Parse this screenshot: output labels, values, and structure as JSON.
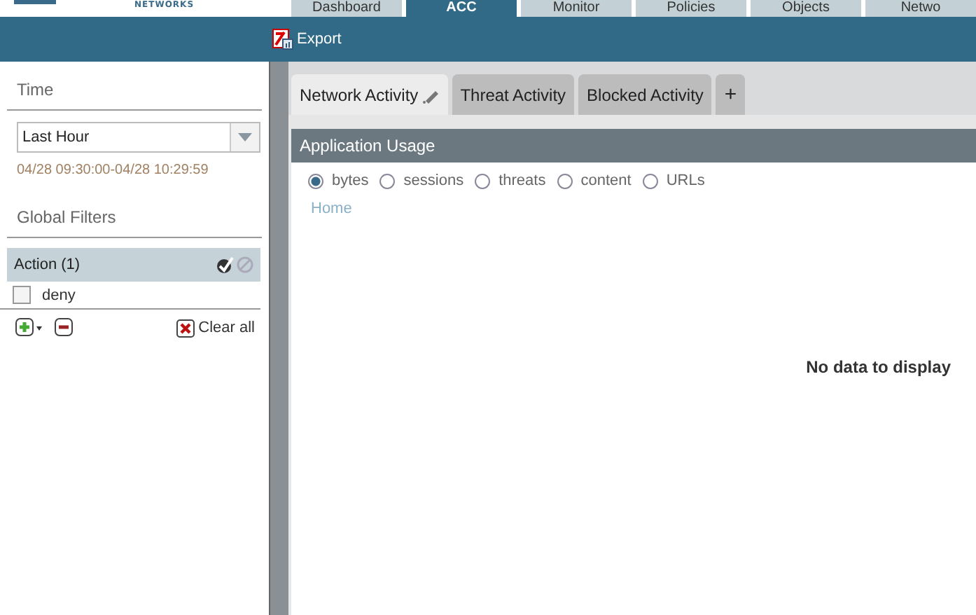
{
  "logo": {
    "subtitle": "NETWORKS"
  },
  "nav_tabs": [
    {
      "label": "Dashboard",
      "selected": false
    },
    {
      "label": "ACC",
      "selected": true
    },
    {
      "label": "Monitor",
      "selected": false
    },
    {
      "label": "Policies",
      "selected": false
    },
    {
      "label": "Objects",
      "selected": false
    },
    {
      "label": "Netwo",
      "selected": false
    }
  ],
  "toolbar": {
    "export_label": "Export"
  },
  "sidebar": {
    "time_heading": "Time",
    "time_select": "Last Hour",
    "time_range": "04/28 09:30:00-04/28 10:29:59",
    "filters_heading": "Global Filters",
    "filter_group": {
      "label": "Action (1)",
      "items": [
        {
          "label": "deny",
          "checked": false
        }
      ]
    },
    "clear_label": "Clear all"
  },
  "tabs": [
    {
      "label": "Network Activity",
      "selected": true,
      "editable": true
    },
    {
      "label": "Threat Activity",
      "selected": false,
      "editable": false
    },
    {
      "label": "Blocked Activity",
      "selected": false,
      "editable": false
    }
  ],
  "add_tab_label": "+",
  "panel": {
    "title": "Application Usage",
    "metrics": [
      {
        "label": "bytes",
        "selected": true
      },
      {
        "label": "sessions",
        "selected": false
      },
      {
        "label": "threats",
        "selected": false
      },
      {
        "label": "content",
        "selected": false
      },
      {
        "label": "URLs",
        "selected": false
      }
    ],
    "breadcrumb": "Home",
    "empty_message": "No data to display"
  }
}
